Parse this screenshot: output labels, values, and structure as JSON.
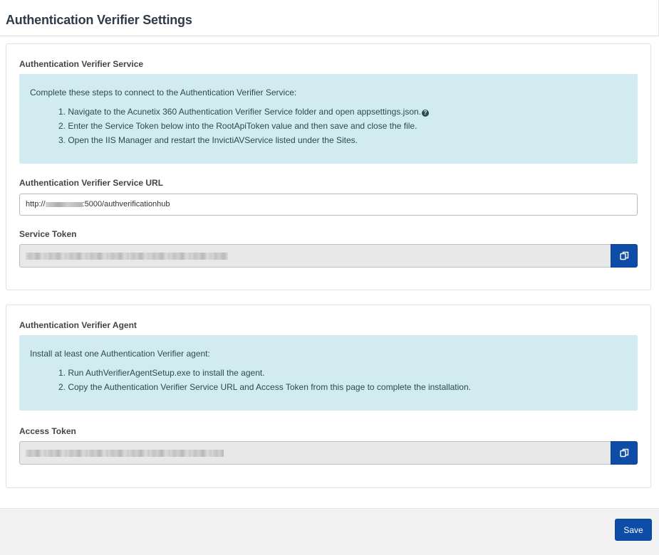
{
  "page": {
    "title": "Authentication Verifier Settings"
  },
  "service": {
    "title": "Authentication Verifier Service",
    "info": {
      "intro": "Complete these steps to connect to the Authentication Verifier Service:",
      "steps": [
        "1. Navigate to the Acunetix 360 Authentication Verifier Service folder and open appsettings.json.",
        "2. Enter the Service Token below into the RootApiToken value and then save and close the file.",
        "3. Open the IIS Manager and restart the InvictiAVService listed under the Sites."
      ],
      "help_icon": "question-circle-icon"
    },
    "url_label": "Authentication Verifier Service URL",
    "url_prefix": "http://",
    "url_suffix": ":5000/authverificationhub",
    "token_label": "Service Token",
    "token_copy_icon": "copy-icon"
  },
  "agent": {
    "title": "Authentication Verifier Agent",
    "info": {
      "intro": "Install at least one Authentication Verifier agent:",
      "steps": [
        "1. Run AuthVerifierAgentSetup.exe to install the agent.",
        "2. Copy the Authentication Verifier Service URL and Access Token from this page to complete the installation."
      ]
    },
    "token_label": "Access Token",
    "token_copy_icon": "copy-icon"
  },
  "footer": {
    "save_label": "Save"
  },
  "colors": {
    "primary": "#0d4da7",
    "info_bg": "#d1ebf0",
    "info_text": "#2b4a52"
  }
}
